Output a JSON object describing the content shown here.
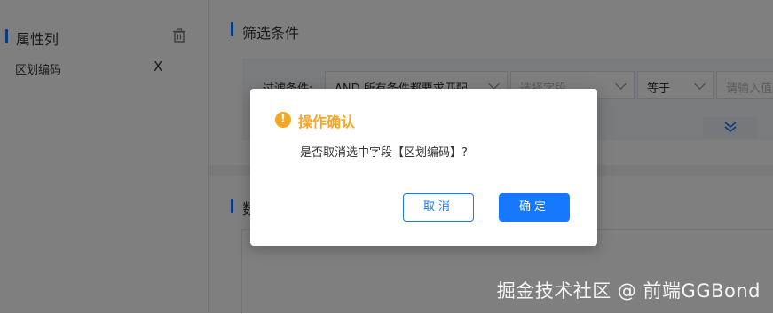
{
  "left_panel": {
    "title": "属性列",
    "items": [
      {
        "label": "区划编码",
        "remove": "X"
      }
    ]
  },
  "filter_section": {
    "title": "筛选条件",
    "label": "过滤条件:",
    "logic_select": "AND 所有条件都要求匹配",
    "field_placeholder": "选择字段",
    "operator_select": "等于",
    "value_placeholder": "请输入值"
  },
  "data_section": {
    "title": "数"
  },
  "dialog": {
    "title": "操作确认",
    "icon": "!",
    "message": "是否取消选中字段【区划编码】?",
    "cancel_label": "取消",
    "ok_label": "确定"
  },
  "watermark": "掘金技术社区 @ 前端GGBond",
  "colors": {
    "primary": "#1677ff",
    "warning": "#f5a623",
    "mask": "rgba(0,0,0,0.5)"
  }
}
